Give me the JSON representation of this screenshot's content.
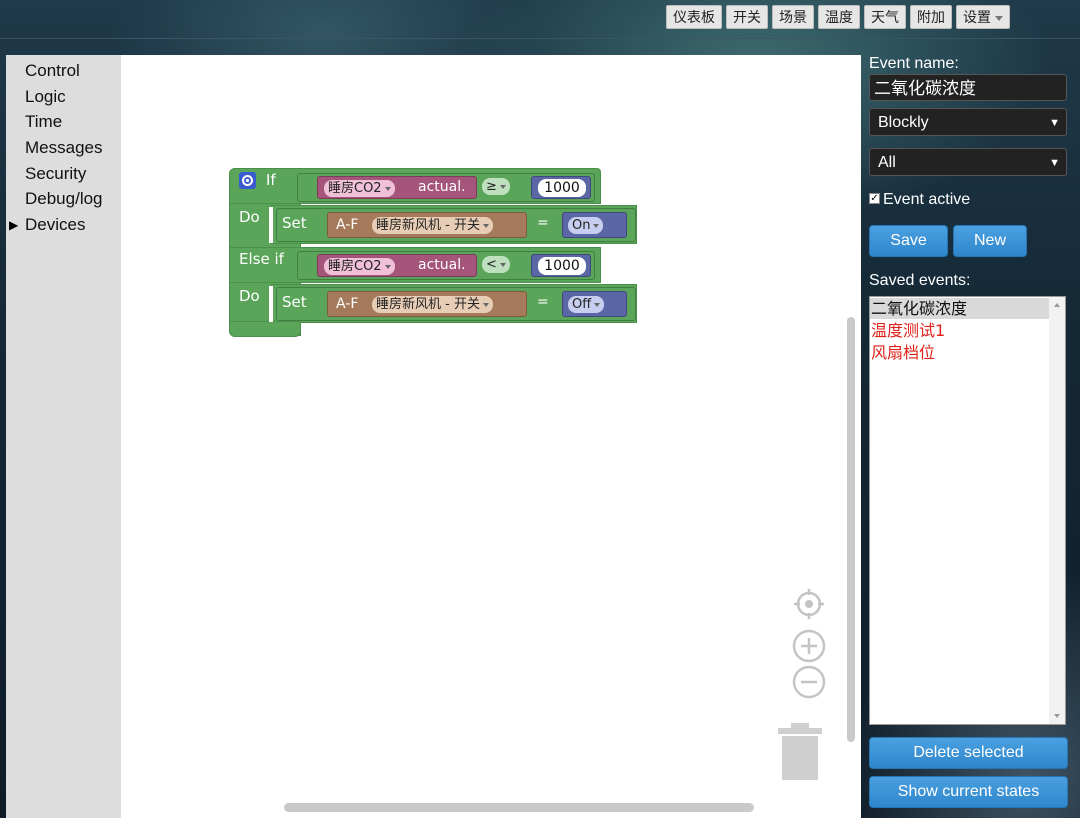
{
  "topnav": {
    "items": [
      "仪表板",
      "开关",
      "场景",
      "温度",
      "天气",
      "附加"
    ],
    "settings": "设置"
  },
  "toolbox": {
    "items": [
      "Control",
      "Logic",
      "Time",
      "Messages",
      "Security",
      "Debug/log",
      "Devices"
    ]
  },
  "blocks": {
    "if_label": "If",
    "do_label": "Do",
    "elseif_label": "Else if",
    "set_label": "Set",
    "cond1": {
      "device": "睡房CO2",
      "prop": "actual.",
      "op": "≥",
      "value": "1000"
    },
    "action1": {
      "type": "A-F",
      "device": "睡房新风机 - 开关",
      "eq": "=",
      "state": "On"
    },
    "cond2": {
      "device": "睡房CO2",
      "prop": "actual.",
      "op": "<",
      "value": "1000"
    },
    "action2": {
      "type": "A-F",
      "device": "睡房新风机 - 开关",
      "eq": "=",
      "state": "Off"
    }
  },
  "panel": {
    "event_name_label": "Event name:",
    "event_name_value": "二氧化碳浓度",
    "type_select": "Blockly",
    "scope_select": "All",
    "event_active_label": "Event active",
    "event_active_checked": true,
    "save_label": "Save",
    "new_label": "New",
    "saved_events_label": "Saved events:",
    "saved_events": [
      {
        "name": "二氧化碳浓度",
        "color": "#111111",
        "selected": true
      },
      {
        "name": "温度测试1",
        "color": "#e0201a",
        "selected": false
      },
      {
        "name": "风扇档位",
        "color": "#e0201a",
        "selected": false
      }
    ],
    "delete_label": "Delete selected",
    "show_label": "Show current states"
  },
  "colors": {
    "accent_blue": "#3a93d6",
    "logic_green": "#5ba55b",
    "device_pink": "#a5547a",
    "device_brown": "#a57a5a",
    "value_blue": "#5b67a5"
  }
}
